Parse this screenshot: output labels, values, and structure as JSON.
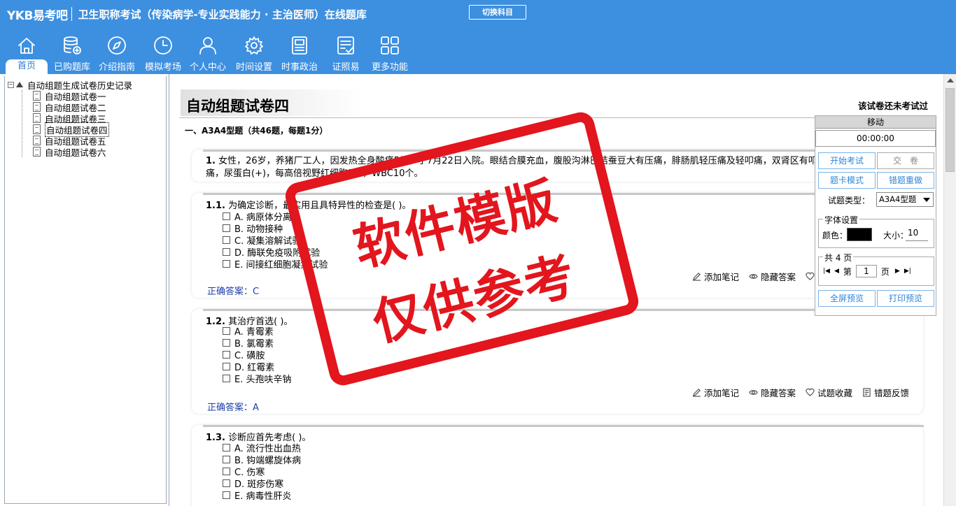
{
  "header": {
    "logo": "YKB易考吧",
    "title": "卫生职称考试（传染病学-专业实践能力 · 主治医师）在线题库",
    "switch_subject": "切换科目"
  },
  "nav": [
    {
      "label": "首页",
      "icon": "home-icon"
    },
    {
      "label": "已购题库",
      "icon": "database-icon"
    },
    {
      "label": "介绍指南",
      "icon": "compass-icon"
    },
    {
      "label": "模拟考场",
      "icon": "clock-icon"
    },
    {
      "label": "个人中心",
      "icon": "user-icon"
    },
    {
      "label": "时间设置",
      "icon": "gear-icon"
    },
    {
      "label": "时事政治",
      "icon": "newspaper-icon"
    },
    {
      "label": "证照易",
      "icon": "certificate-icon"
    },
    {
      "label": "更多功能",
      "icon": "grid-icon"
    }
  ],
  "sidebar": {
    "root": "自动组题生成试卷历史记录",
    "items": [
      "自动组题试卷一",
      "自动组题试卷二",
      "自动组题试卷三",
      "自动组题试卷四",
      "自动组题试卷五",
      "自动组题试卷六"
    ],
    "selected": "自动组题试卷四"
  },
  "main": {
    "paper_title": "自动组题试卷四",
    "paper_status": "该试卷还未考试过",
    "section_heading": "一、A3A4型题（共46题，每题1分）",
    "case": {
      "num": "1.",
      "text": "女性，26岁，养猪厂工人，因发热全身酸痛5日，于7月22日入院。眼结合膜充血，腹股沟淋巴结蚕豆大有压痛，腓肠肌轻压痛及轻叩痛，双肾区有叩击痛，尿蛋白(+)，每高倍视野红细胞3个，WBC10个。"
    },
    "questions": [
      {
        "num": "1.1.",
        "stem": "为确定诊断，最实用且具特异性的检查是( )。",
        "options": [
          "A. 病原体分离",
          "B. 动物接种",
          "C. 凝集溶解试验",
          "D. 酶联免疫吸附试验",
          "E. 间接红细胞凝集试验"
        ],
        "answer_label": "正确答案：",
        "answer": "C"
      },
      {
        "num": "1.2.",
        "stem": "其治疗首选( )。",
        "options": [
          "A. 青霉素",
          "B. 氯霉素",
          "C. 磺胺",
          "D. 红霉素",
          "E. 头孢呋辛钠"
        ],
        "answer_label": "正确答案：",
        "answer": "A"
      },
      {
        "num": "1.3.",
        "stem": "诊断应首先考虑( )。",
        "options": [
          "A. 流行性出血热",
          "B. 钩端螺旋体病",
          "C. 伤寒",
          "D. 斑疹伤寒",
          "E. 病毒性肝炎"
        ]
      }
    ],
    "tools": [
      "添加笔记",
      "隐藏答案",
      "试题收藏",
      "错题反馈"
    ]
  },
  "panel": {
    "move": "移动",
    "timer": "00:00:00",
    "start_exam": "开始考试",
    "submit": "交　卷",
    "card_mode": "题卡模式",
    "redo_wrong": "错题重做",
    "qtype_label": "试题类型：",
    "qtype_value": "A3A4型题",
    "font_legend": "字体设置",
    "font_color_label": "颜色：",
    "font_size_label": "大小：",
    "font_size_value": "10",
    "pages_legend": "共 4 页",
    "page_prefix": "第",
    "page_value": "1",
    "page_suffix": "页",
    "fullscreen": "全屏预览",
    "print": "打印预览"
  },
  "watermark": {
    "line1": "软件模版",
    "line2": "仅供参考"
  },
  "colors": {
    "header_bg": "#3d8fe0",
    "stamp": "#e3151d",
    "answer": "#1f3ea8",
    "panel_button": "#2d86d9"
  }
}
